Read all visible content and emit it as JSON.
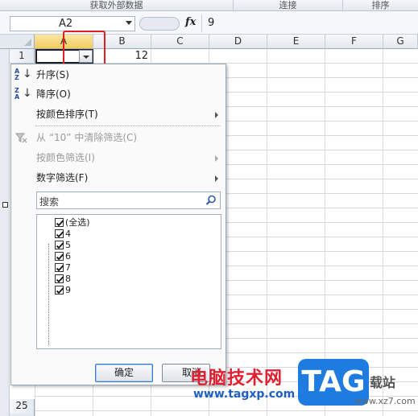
{
  "ribbon": {
    "groups": [
      "获取外部数据",
      "连接",
      "排序"
    ]
  },
  "formula_bar": {
    "name_box": "A2",
    "fx_label": "fx",
    "value": "9"
  },
  "sheet": {
    "columns": [
      "A",
      "B",
      "C",
      "D",
      "E",
      "F",
      "G"
    ],
    "rows": [
      "1",
      "25"
    ],
    "cell_b1": "12",
    "active_column": "A"
  },
  "filter_menu": {
    "sort_asc": "升序(S)",
    "sort_desc": "降序(O)",
    "sort_by_color": "按颜色排序(T)",
    "clear_filter": "从 “10” 中清除筛选(C)",
    "filter_by_color": "按颜色筛选(I)",
    "number_filters": "数字筛选(F)",
    "search_placeholder": "搜索",
    "items": [
      "(全选)",
      "4",
      "5",
      "6",
      "7",
      "8",
      "9"
    ],
    "ok_label": "确定",
    "cancel_label": "取消"
  },
  "watermark": {
    "cn_text": "电脑技术网",
    "url": "www.tagxp.com",
    "logo_text": "TAG",
    "station_text": "载站",
    "url2": "www.xz7.com"
  },
  "colors": {
    "highlight_box": "#e02020",
    "active_header": "#f3cc5e",
    "watermark_red": "#e02030",
    "watermark_blue": "#1e7be0"
  }
}
